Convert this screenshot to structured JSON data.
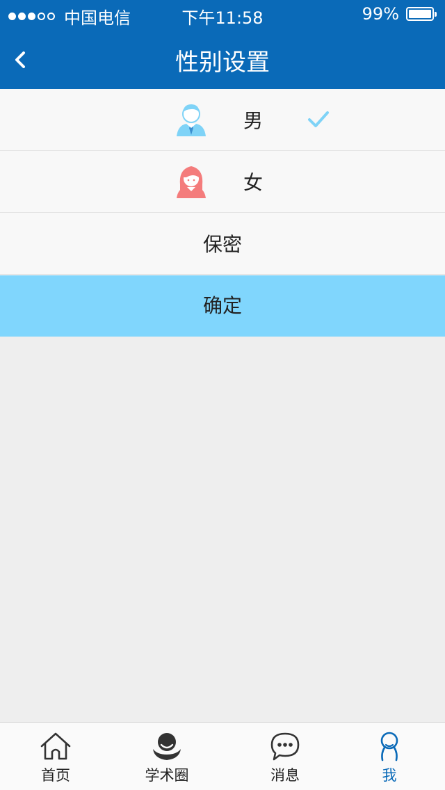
{
  "statusbar": {
    "carrier": "中国电信",
    "time": "下午11:58",
    "battery": "99%",
    "signal_strength": 3
  },
  "navbar": {
    "title": "性别设置",
    "back_icon": "chevron-left-icon"
  },
  "options": [
    {
      "label": "男",
      "icon": "male-avatar-icon",
      "selected": true
    },
    {
      "label": "女",
      "icon": "female-avatar-icon",
      "selected": false
    },
    {
      "label": "保密",
      "selected": false
    }
  ],
  "confirm_label": "确定",
  "tabs": [
    {
      "label": "首页",
      "icon": "home-icon",
      "active": false
    },
    {
      "label": "学术圈",
      "icon": "academic-circle-icon",
      "active": false
    },
    {
      "label": "消息",
      "icon": "message-icon",
      "active": false
    },
    {
      "label": "我",
      "icon": "profile-icon",
      "active": true
    }
  ],
  "colors": {
    "primary": "#0a6ab8",
    "confirm_bg": "#80d6fd",
    "check": "#7fd3f7",
    "male_avatar": "#7fd3f7",
    "female_avatar": "#f47c7c",
    "background": "#eeeeee"
  }
}
